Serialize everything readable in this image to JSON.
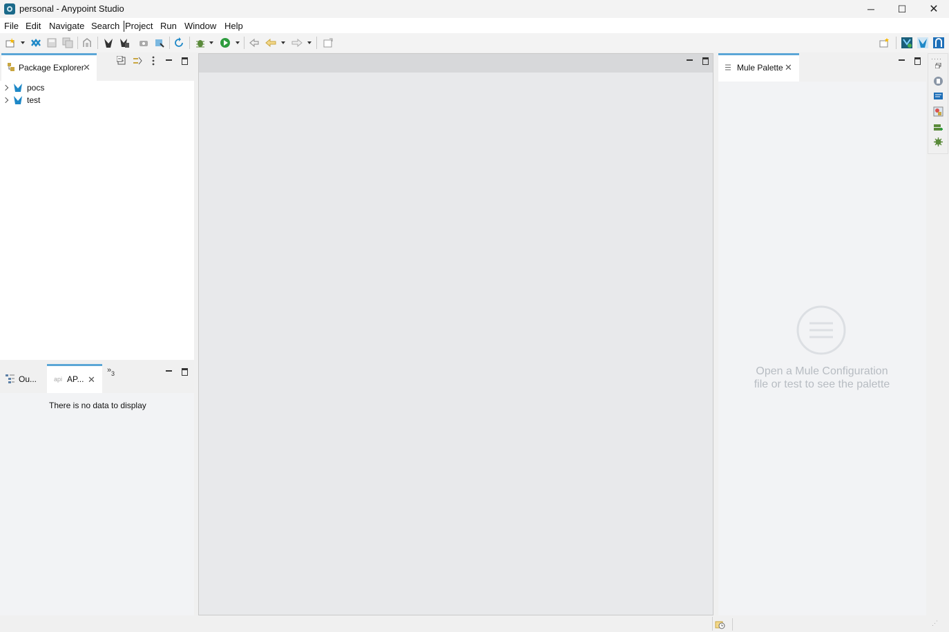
{
  "window": {
    "title": "personal - Anypoint Studio",
    "controls": {
      "minimize": "─",
      "maximize": "☐",
      "close": "✕"
    }
  },
  "menu": [
    "File",
    "Edit",
    "Navigate",
    "Search",
    "Project",
    "Run",
    "Window",
    "Help"
  ],
  "package_explorer": {
    "tab_label": "Package Explorer",
    "projects": [
      "pocs",
      "test"
    ]
  },
  "bottom_left": {
    "outline_tab": "Ou...",
    "api_tab": "AP...",
    "api_tab_prefix": "api",
    "overflow_count": "3",
    "empty_message": "There is no data to display"
  },
  "mule_palette": {
    "tab_label": "Mule Palette",
    "empty_message_line1": "Open a Mule Configuration",
    "empty_message_line2": "file or test to see the palette"
  },
  "colors": {
    "accent": "#5ba6d6",
    "editor_bg": "#e8e9eb",
    "palette_bg": "#f2f3f5",
    "placeholder_text": "#b7bcc2"
  }
}
